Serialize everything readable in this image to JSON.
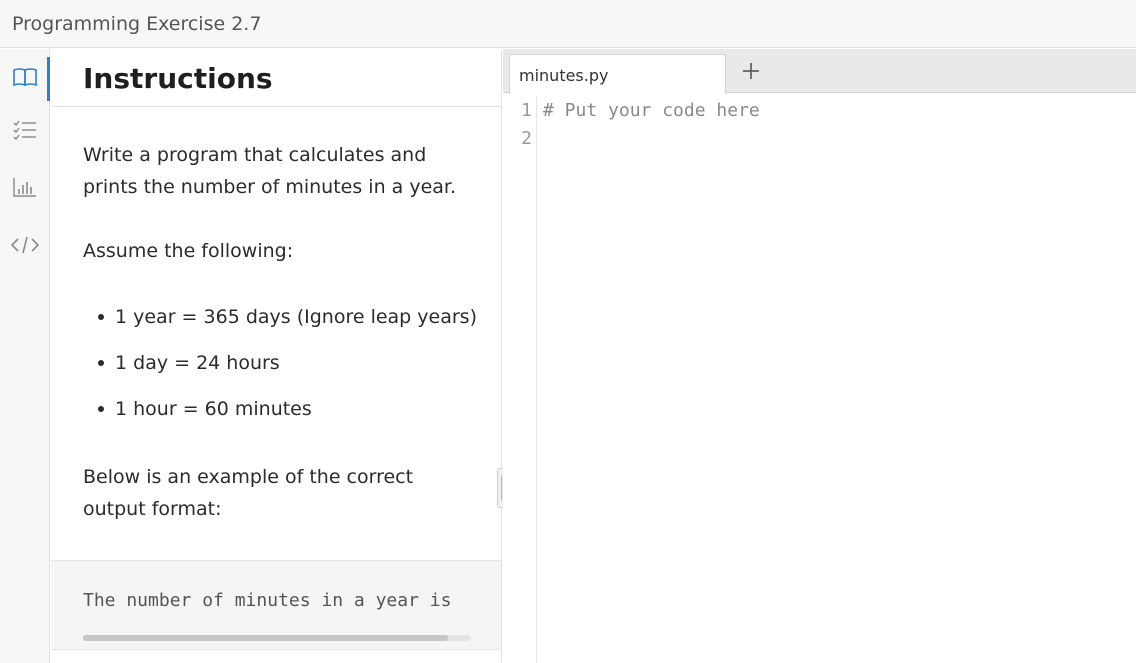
{
  "window": {
    "title": "Programming Exercise 2.7"
  },
  "rail": {
    "items": [
      {
        "icon": "book-icon",
        "active": true
      },
      {
        "icon": "checklist-icon",
        "active": false
      },
      {
        "icon": "bar-chart-icon",
        "active": false
      },
      {
        "icon": "code-icon",
        "active": false
      }
    ],
    "accent": "#2e7fd1"
  },
  "instructions": {
    "title": "Instructions",
    "paragraph1": "Write a program that calculates and prints the number of minutes in a year.",
    "paragraph2": "Assume the following:",
    "bullets": [
      "1 year = 365 days (Ignore leap years)",
      "1 day = 24 hours",
      "1 hour = 60 minutes"
    ],
    "paragraph3": "Below is an example of the correct output format:",
    "example_output": "The number of minutes in a year is"
  },
  "editor": {
    "tabs": [
      {
        "label": "minutes.py",
        "active": true
      }
    ],
    "add_tab_label": "+",
    "lines": [
      {
        "number": "1",
        "text": "# Put your code here"
      },
      {
        "number": "2",
        "text": ""
      }
    ]
  }
}
